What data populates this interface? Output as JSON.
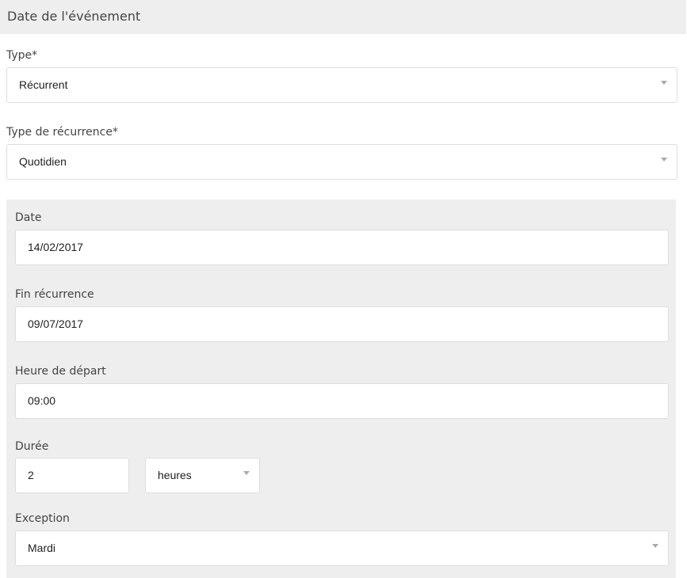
{
  "section": {
    "title": "Date de l'événement"
  },
  "type_field": {
    "label": "Type*",
    "value": "Récurrent"
  },
  "recurrence_type_field": {
    "label": "Type de récurrence*",
    "value": "Quotidien"
  },
  "recurrence": {
    "date": {
      "label": "Date",
      "value": "14/02/2017"
    },
    "end": {
      "label": "Fin récurrence",
      "value": "09/07/2017"
    },
    "start_time": {
      "label": "Heure de départ",
      "value": "09:00"
    },
    "duration": {
      "label": "Durée",
      "value": "2",
      "unit": "heures"
    },
    "exception": {
      "label": "Exception",
      "value": "Mardi"
    }
  }
}
